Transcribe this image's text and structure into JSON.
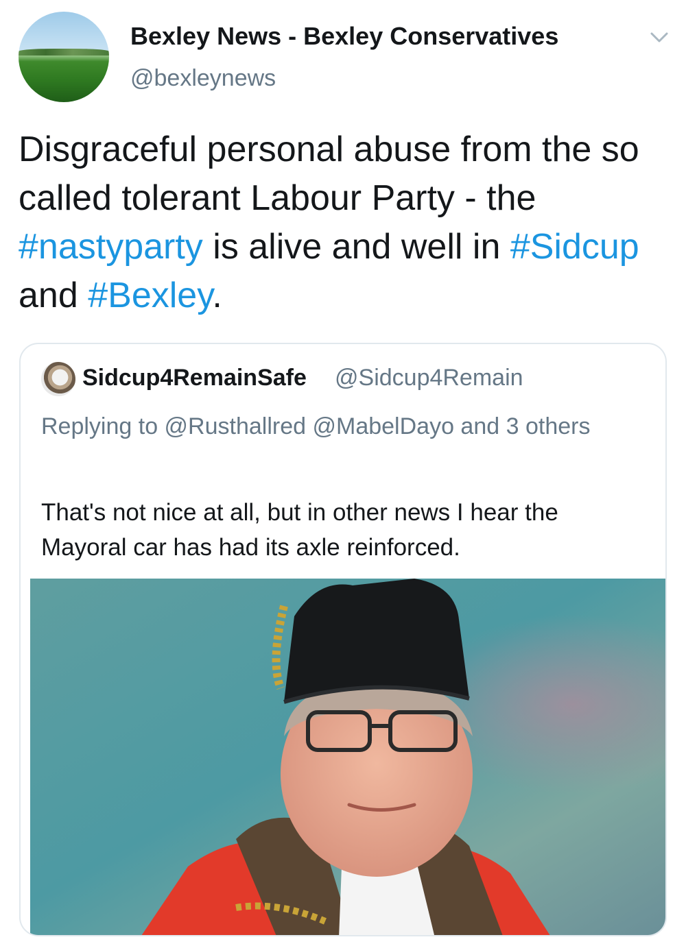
{
  "author": {
    "name": "Bexley News - Bexley Conservatives",
    "handle": "@bexleynews",
    "avatar_icon": "profile-avatar-green-field"
  },
  "tweet": {
    "segments": [
      {
        "text": "Disgraceful personal abuse from the so called tolerant Labour Party - the ",
        "type": "text"
      },
      {
        "text": "#nastyparty",
        "type": "hashtag"
      },
      {
        "text": " is alive and well in ",
        "type": "text"
      },
      {
        "text": "#Sidcup",
        "type": "hashtag"
      },
      {
        "text": " and ",
        "type": "text"
      },
      {
        "text": "#Bexley",
        "type": "hashtag"
      },
      {
        "text": ".",
        "type": "text"
      }
    ]
  },
  "quoted": {
    "name": "Sidcup4RemainSafe",
    "handle": "@Sidcup4Remain",
    "reply_prefix": "Replying to ",
    "reply_mentions": "@Rusthallred @MabelDayo",
    "reply_suffix": " and 3 others",
    "text": "That's not nice at all, but in other news I hear the Mayoral car has had its axle reinforced.",
    "avatar_icon": "profile-avatar-cat",
    "photo": "portrait-photo"
  },
  "colors": {
    "text": "#14171a",
    "secondary": "#657786",
    "link": "#1b95e0",
    "border": "#e1e8ed"
  },
  "icons": {
    "menu": "chevron-down-icon"
  }
}
